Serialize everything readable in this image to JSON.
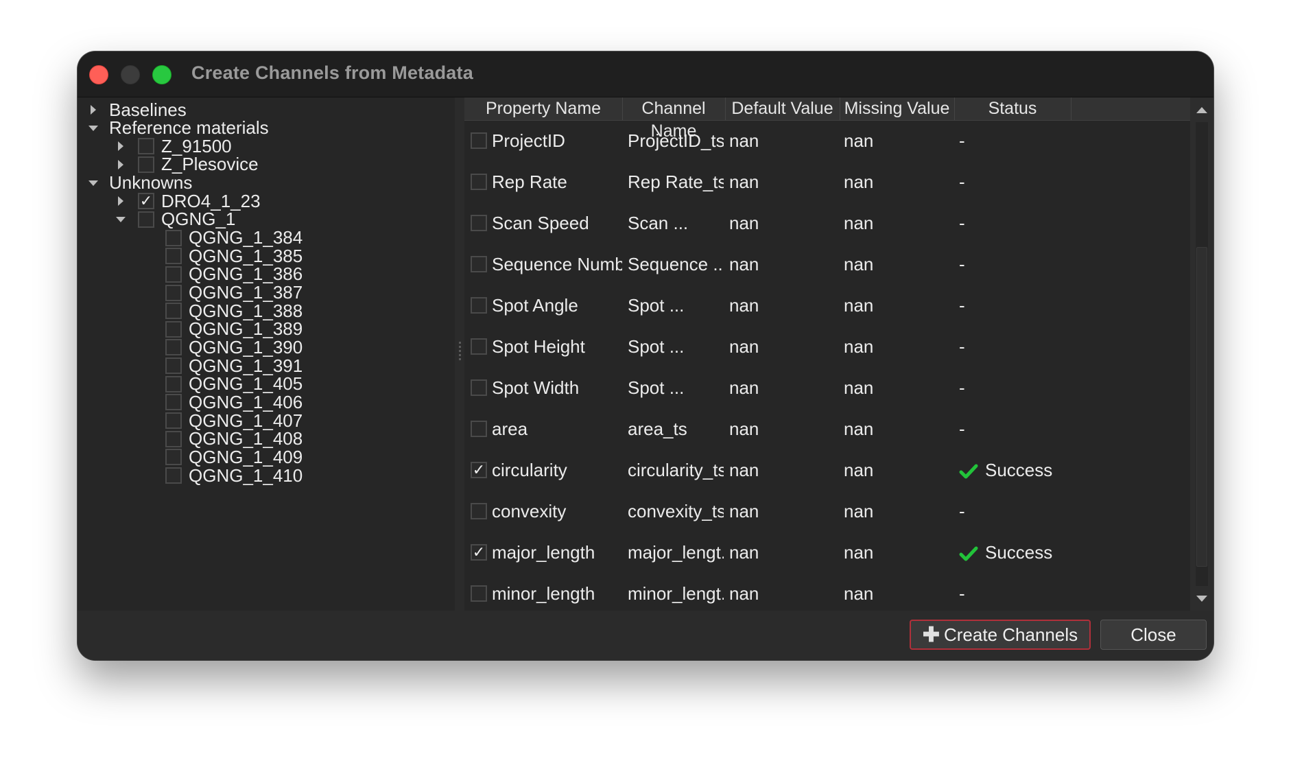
{
  "window": {
    "title": "Create Channels from Metadata"
  },
  "tree": {
    "nodes": [
      {
        "label": "Baselines",
        "expanded": false,
        "checked": null
      },
      {
        "label": "Reference materials",
        "expanded": true,
        "checked": null
      },
      {
        "label": "Z_91500",
        "expanded": false,
        "checked": false
      },
      {
        "label": "Z_Plesovice",
        "expanded": false,
        "checked": false
      },
      {
        "label": "Unknowns",
        "expanded": true,
        "checked": null
      },
      {
        "label": "DRO4_1_23",
        "expanded": false,
        "checked": true
      },
      {
        "label": "QGNG_1",
        "expanded": true,
        "checked": false
      },
      {
        "label": "QGNG_1_384",
        "checked": false
      },
      {
        "label": "QGNG_1_385",
        "checked": false
      },
      {
        "label": "QGNG_1_386",
        "checked": false
      },
      {
        "label": "QGNG_1_387",
        "checked": false
      },
      {
        "label": "QGNG_1_388",
        "checked": false
      },
      {
        "label": "QGNG_1_389",
        "checked": false
      },
      {
        "label": "QGNG_1_390",
        "checked": false
      },
      {
        "label": "QGNG_1_391",
        "checked": false
      },
      {
        "label": "QGNG_1_405",
        "checked": false
      },
      {
        "label": "QGNG_1_406",
        "checked": false
      },
      {
        "label": "QGNG_1_407",
        "checked": false
      },
      {
        "label": "QGNG_1_408",
        "checked": false
      },
      {
        "label": "QGNG_1_409",
        "checked": false
      },
      {
        "label": "QGNG_1_410",
        "checked": false
      }
    ]
  },
  "table": {
    "columns": [
      "Property Name",
      "Channel Name",
      "Default Value",
      "Missing Value",
      "Status"
    ],
    "rows": [
      {
        "checked": false,
        "property": "ProjectID",
        "channel": "ProjectID_ts",
        "default": "nan",
        "missing": "nan",
        "status": "-"
      },
      {
        "checked": false,
        "property": "Rep Rate",
        "channel": "Rep Rate_ts",
        "default": "nan",
        "missing": "nan",
        "status": "-"
      },
      {
        "checked": false,
        "property": "Scan Speed",
        "channel": "Scan ...",
        "default": "nan",
        "missing": "nan",
        "status": "-"
      },
      {
        "checked": false,
        "property": "Sequence Number",
        "channel": "Sequence ...",
        "default": "nan",
        "missing": "nan",
        "status": "-"
      },
      {
        "checked": false,
        "property": "Spot Angle",
        "channel": "Spot ...",
        "default": "nan",
        "missing": "nan",
        "status": "-"
      },
      {
        "checked": false,
        "property": "Spot Height",
        "channel": "Spot ...",
        "default": "nan",
        "missing": "nan",
        "status": "-"
      },
      {
        "checked": false,
        "property": "Spot Width",
        "channel": "Spot ...",
        "default": "nan",
        "missing": "nan",
        "status": "-"
      },
      {
        "checked": false,
        "property": "area",
        "channel": "area_ts",
        "default": "nan",
        "missing": "nan",
        "status": "-"
      },
      {
        "checked": true,
        "property": "circularity",
        "channel": "circularity_ts",
        "default": "nan",
        "missing": "nan",
        "status": "Success",
        "status_icon": "green-check-icon"
      },
      {
        "checked": false,
        "property": "convexity",
        "channel": "convexity_ts",
        "default": "nan",
        "missing": "nan",
        "status": "-"
      },
      {
        "checked": true,
        "property": "major_length",
        "channel": "major_lengt...",
        "default": "nan",
        "missing": "nan",
        "status": "Success",
        "status_icon": "green-check-icon"
      },
      {
        "checked": false,
        "property": "minor_length",
        "channel": "minor_lengt...",
        "default": "nan",
        "missing": "nan",
        "status": "-"
      }
    ]
  },
  "buttons": {
    "create_label": "Create Channels",
    "create_icon": "plus-icon",
    "close_label": "Close"
  },
  "colors": {
    "success": "#22c33a",
    "primary_border": "#b0303a",
    "close_light": "#ff5f57",
    "zoom_light": "#28c840"
  }
}
